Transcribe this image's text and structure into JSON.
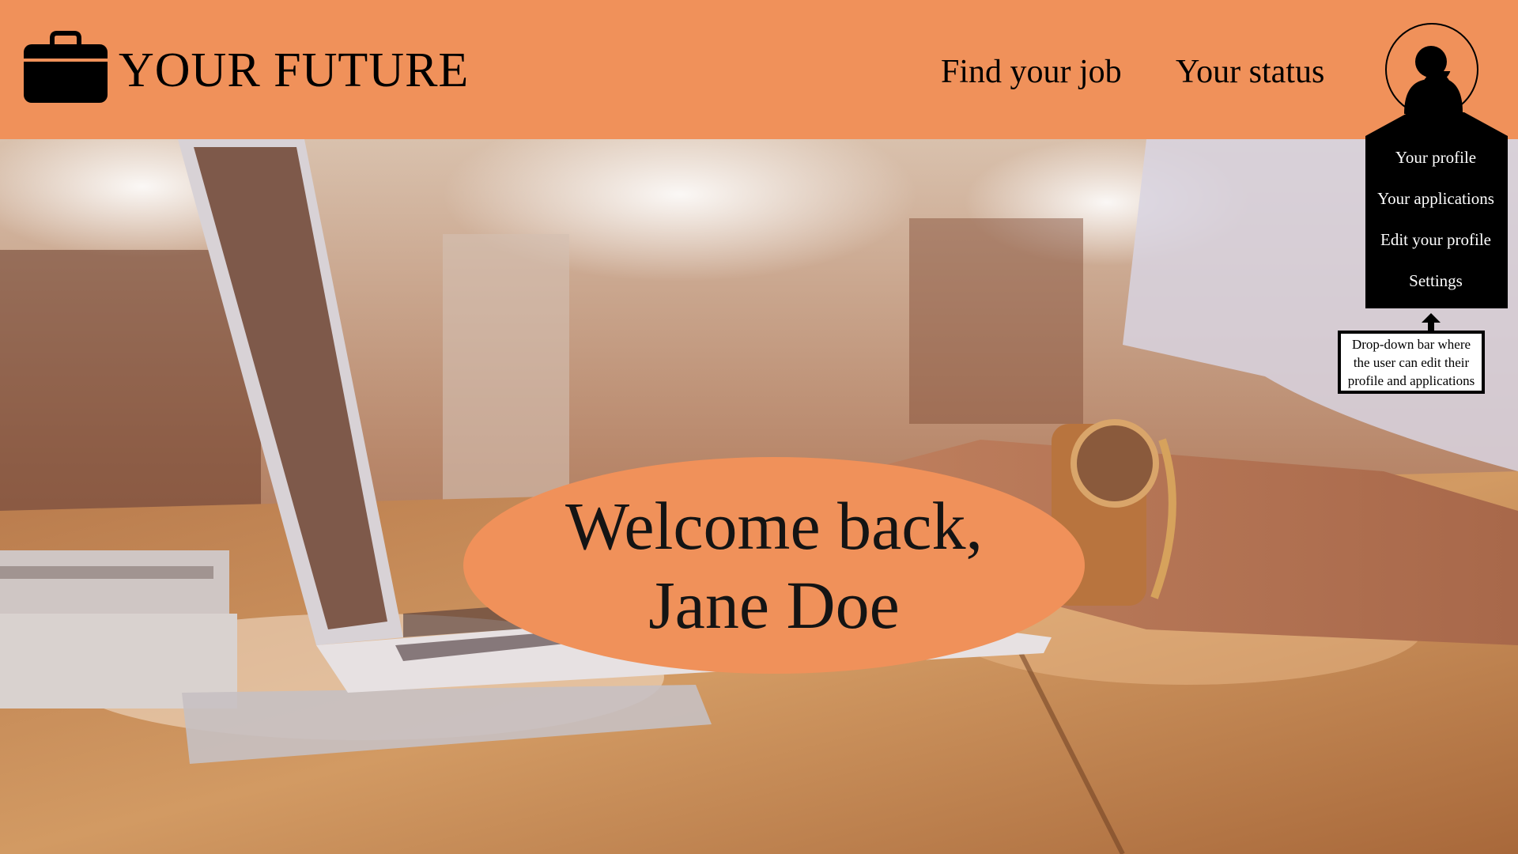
{
  "app": {
    "brand": "YOUR FUTURE",
    "logo_icon": "briefcase-icon",
    "accent_color": "#f0915a"
  },
  "nav": {
    "items": [
      {
        "label": "Find your job"
      },
      {
        "label": "Your status"
      }
    ],
    "profile_icon": "user-avatar-icon"
  },
  "profile_menu": {
    "items": [
      {
        "label": "Your profile"
      },
      {
        "label": "Your applications"
      },
      {
        "label": "Edit your profile"
      },
      {
        "label": "Settings"
      }
    ]
  },
  "annotation": {
    "lines": [
      "Drop-down bar where",
      "the user can edit their",
      "profile and applications"
    ]
  },
  "hero": {
    "background": "photo: hands typing on a laptop on a wooden desk",
    "welcome_line1": "Welcome back,",
    "welcome_line2": "Jane Doe"
  }
}
